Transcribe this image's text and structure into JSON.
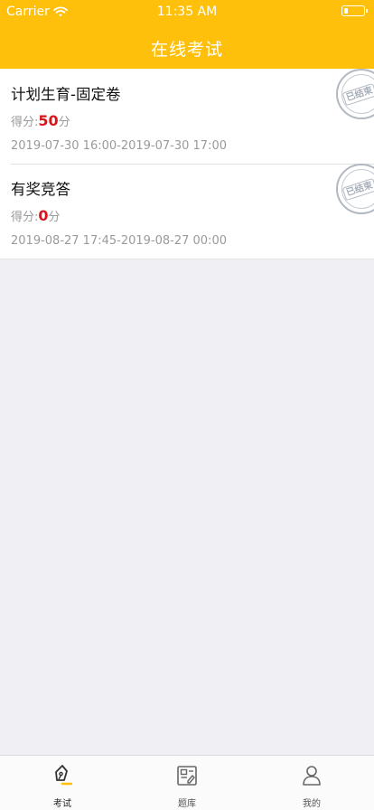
{
  "status_bar": {
    "carrier": "Carrier",
    "time": "11:35 AM",
    "battery_level": 0.2
  },
  "nav": {
    "title": "在线考试"
  },
  "exams": [
    {
      "title": "计划生育-固定卷",
      "score_label": "得分:",
      "score": "50",
      "score_unit": "分",
      "time": "2019-07-30 16:00-2019-07-30 17:00",
      "stamp": "已结束"
    },
    {
      "title": "有奖竞答",
      "score_label": "得分:",
      "score": "0",
      "score_unit": "分",
      "time": "2019-08-27 17:45-2019-08-27 00:00",
      "stamp": "已结束"
    }
  ],
  "tabs": [
    {
      "label": "考试",
      "icon": "pen-icon",
      "active": true
    },
    {
      "label": "题库",
      "icon": "question-bank-icon",
      "active": false
    },
    {
      "label": "我的",
      "icon": "person-icon",
      "active": false
    }
  ],
  "colors": {
    "brand": "#fec00b",
    "score": "#d9141c",
    "background": "#efeff4"
  }
}
